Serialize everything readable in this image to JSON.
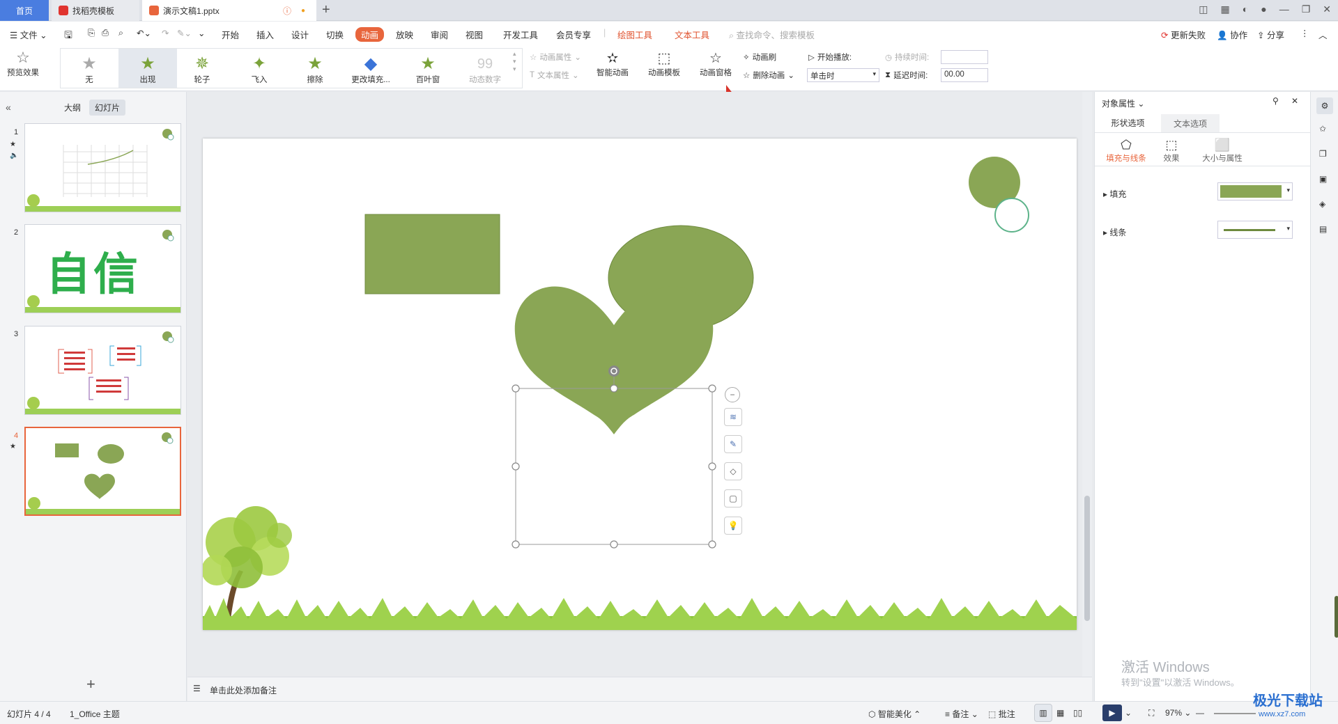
{
  "tabs": {
    "home": "首页",
    "docer": "找稻壳模板",
    "doc": "演示文稿1.pptx"
  },
  "menu": {
    "file": "文件",
    "items": [
      "开始",
      "插入",
      "设计",
      "切换",
      "动画",
      "放映",
      "审阅",
      "视图",
      "开发工具",
      "会员专享"
    ],
    "drawing_tools": "绘图工具",
    "text_tools": "文本工具",
    "search": "查找命令、搜索模板",
    "update_failed": "更新失败",
    "collab": "协作",
    "share": "分享"
  },
  "toolbar": {
    "preview": "预览效果",
    "gallery": [
      "无",
      "出现",
      "轮子",
      "飞入",
      "擦除",
      "更改填充...",
      "百叶窗",
      "动态数字"
    ],
    "anim_props": "动画属性",
    "text_props": "文本属性",
    "smart_anim": "智能动画",
    "anim_template": "动画模板",
    "anim_pane": "动画窗格",
    "anim_brush": "动画刷",
    "delete_anim": "删除动画",
    "start_label": "开始播放:",
    "start_value": "单击时",
    "duration_label": "持续时间:",
    "duration_value": "",
    "delay_label": "延迟时间:",
    "delay_value": "00.00"
  },
  "left": {
    "outline_tab": "大纲",
    "slides_tab": "幻灯片",
    "slides": [
      "1",
      "2",
      "3",
      "4"
    ],
    "slide2_text": "自信",
    "add": "+"
  },
  "notes": {
    "placeholder": "单击此处添加备注"
  },
  "right": {
    "title": "对象属性",
    "tab_shape": "形状选项",
    "tab_text": "文本选项",
    "sub_fill": "填充与线条",
    "sub_effect": "效果",
    "sub_size": "大小与属性",
    "fill": "填充",
    "line": "线条",
    "fill_color": "#8aa655"
  },
  "watermark": {
    "line1": "激活 Windows",
    "line2": "转到\"设置\"以激活 Windows。"
  },
  "site": {
    "logo": "极光下载站",
    "url": "www.xz7.com"
  },
  "status": {
    "slide": "幻灯片 4 / 4",
    "theme": "1_Office 主题",
    "beautify": "智能美化",
    "notes": "备注",
    "comment": "批注",
    "zoom": "97%"
  },
  "colors": {
    "shape": "#8aa655",
    "accent": "#e8653c",
    "grass": "#8cc63f"
  }
}
